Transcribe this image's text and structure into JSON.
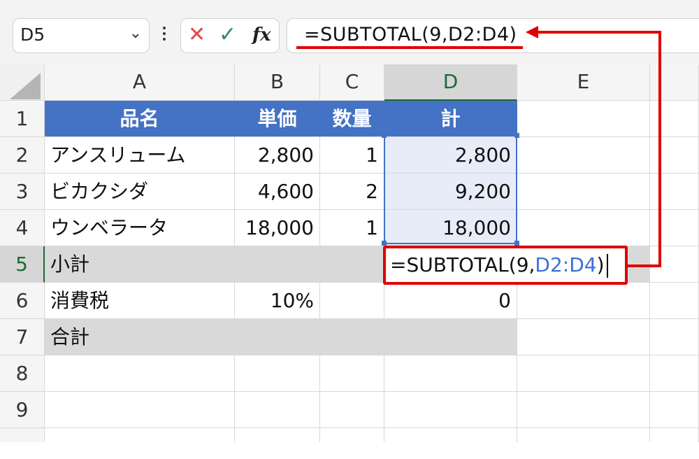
{
  "name_box": {
    "value": "D5"
  },
  "formula_bar": {
    "value": "=SUBTOTAL(9,D2:D4)",
    "cancel_icon": "cancel-x-icon",
    "enter_icon": "check-icon",
    "fx_label": "fx"
  },
  "columns": [
    "A",
    "B",
    "C",
    "D",
    "E"
  ],
  "rows": [
    "1",
    "2",
    "3",
    "4",
    "5",
    "6",
    "7",
    "8",
    "9"
  ],
  "table": {
    "header": [
      "品名",
      "単価",
      "数量",
      "計"
    ],
    "r2": {
      "a": "アンスリューム",
      "b": "2,800",
      "c": "1",
      "d": "2,800"
    },
    "r3": {
      "a": "ビカクシダ",
      "b": "4,600",
      "c": "2",
      "d": "9,200"
    },
    "r4": {
      "a": "ウンベラータ",
      "b": "18,000",
      "c": "1",
      "d": "18,000"
    },
    "r5": {
      "a": "小計",
      "d_prefix": "=SUBTOTAL(9,",
      "d_ref": "D2:D4",
      "d_suffix": ")"
    },
    "r6": {
      "a": "消費税",
      "b": "10%",
      "d": "0"
    },
    "r7": {
      "a": "合計"
    }
  },
  "colors": {
    "header_fill": "#4472c4",
    "gray_fill": "#d9d9d9",
    "annotation_red": "#e00000",
    "ref_blue": "#3d6fd8"
  }
}
